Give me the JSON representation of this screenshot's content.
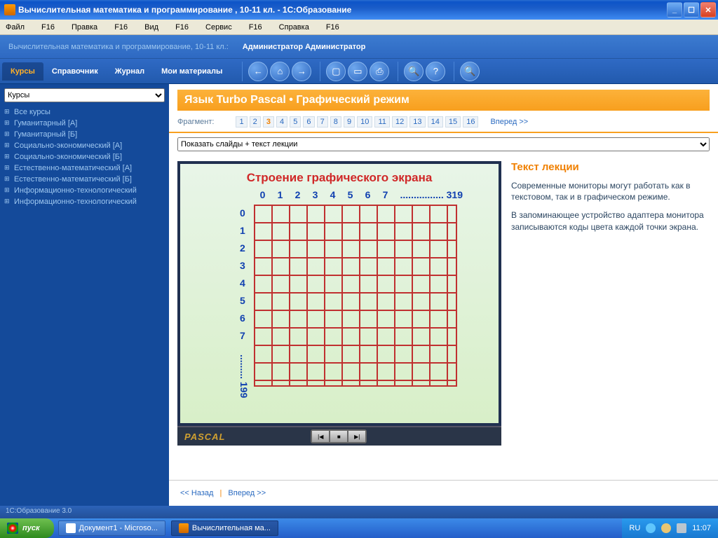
{
  "window": {
    "title": "Вычислительная математика и программирование , 10-11 кл. - 1С:Образование"
  },
  "menu": {
    "file": "Файл",
    "f16": "F16",
    "edit": "Правка",
    "view": "Вид",
    "service": "Сервис",
    "help": "Справка"
  },
  "strip": {
    "crumb": "Вычислительная математика и программирование, 10-11 кл.:",
    "user": "Администратор Администратор"
  },
  "tabs": {
    "courses": "Курсы",
    "ref": "Справочник",
    "journal": "Журнал",
    "materials": "Мои материалы"
  },
  "sidebar": {
    "select": "Курсы",
    "items": [
      "Все курсы",
      "Гуманитарный [А]",
      "Гуманитарный [Б]",
      "Социально-экономический [А]",
      "Социально-экономический [Б]",
      "Естественно-математический [А]",
      "Естественно-математический [Б]",
      "Информационно-технологический",
      "Информационно-технологический"
    ]
  },
  "page": {
    "title": "Язык Turbo Pascal • Графический режим",
    "frag_label": "Фрагмент:",
    "frags": [
      "1",
      "2",
      "3",
      "4",
      "5",
      "6",
      "7",
      "8",
      "9",
      "10",
      "11",
      "12",
      "13",
      "14",
      "15",
      "16"
    ],
    "current_frag": "3",
    "forward": "Вперед >>",
    "show_select": "Показать слайды + текст лекции"
  },
  "slide": {
    "title": "Строение графического  экрана",
    "x_nums": [
      "0",
      "1",
      "2",
      "3",
      "4",
      "5",
      "6",
      "7"
    ],
    "x_end": "................ 319",
    "y_nums": [
      "0",
      "1",
      "2",
      "3",
      "4",
      "5",
      "6",
      "7"
    ],
    "y_end": "......... 199",
    "caption": "PASCAL"
  },
  "lecture": {
    "title": "Текст лекции",
    "p1": "Современные мониторы могут работать как в текстовом, так и в графическом режиме.",
    "p2": "В запоминающее устройство адаптера монитора записываются коды цвета каждой точки экрана."
  },
  "bottomnav": {
    "back": "<< Назад",
    "fwd": "Вперед >>"
  },
  "status": "1С:Образование 3.0",
  "taskbar": {
    "start": "пуск",
    "task1": "Документ1 - Microso...",
    "task2": "Вычислительная ма...",
    "lang": "RU",
    "clock": "11:07"
  }
}
